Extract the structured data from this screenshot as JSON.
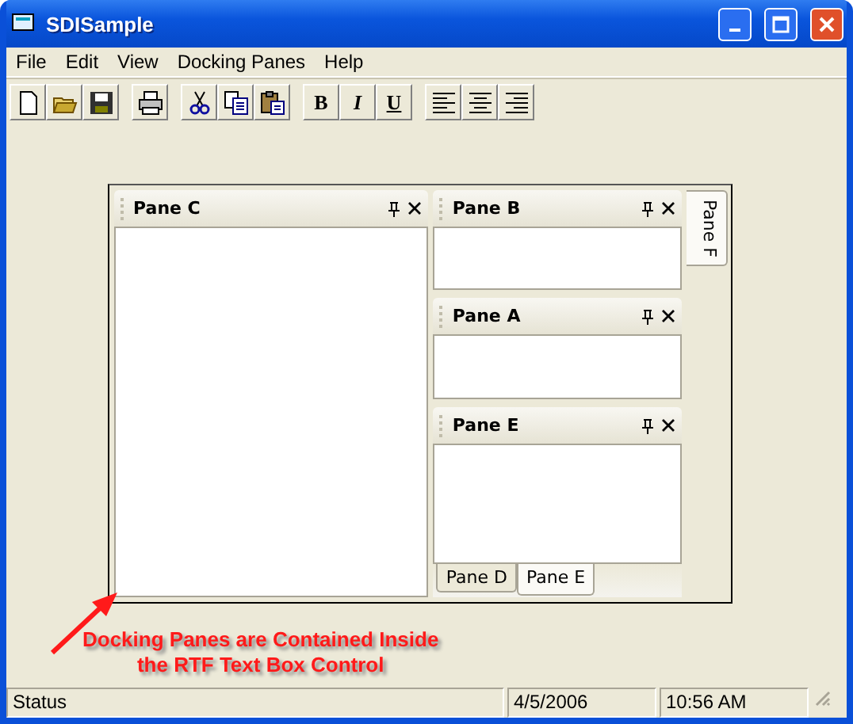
{
  "window": {
    "title": "SDISample"
  },
  "menu": [
    "File",
    "Edit",
    "View",
    "Docking Panes",
    "Help"
  ],
  "format_buttons": [
    "B",
    "I",
    "U"
  ],
  "left_pane": {
    "title": "Pane C"
  },
  "right_panes": [
    {
      "title": "Pane B"
    },
    {
      "title": "Pane A"
    },
    {
      "title": "Pane E",
      "tabs": [
        {
          "label": "Pane D",
          "selected": false
        },
        {
          "label": "Pane E",
          "selected": true
        }
      ]
    }
  ],
  "side_tabs": [
    {
      "label": "Pane F"
    }
  ],
  "annotation": [
    "Docking Panes are Contained Inside",
    "the RTF Text Box Control"
  ],
  "status_bar": [
    "Status",
    "4/5/2006",
    "10:56 AM"
  ]
}
